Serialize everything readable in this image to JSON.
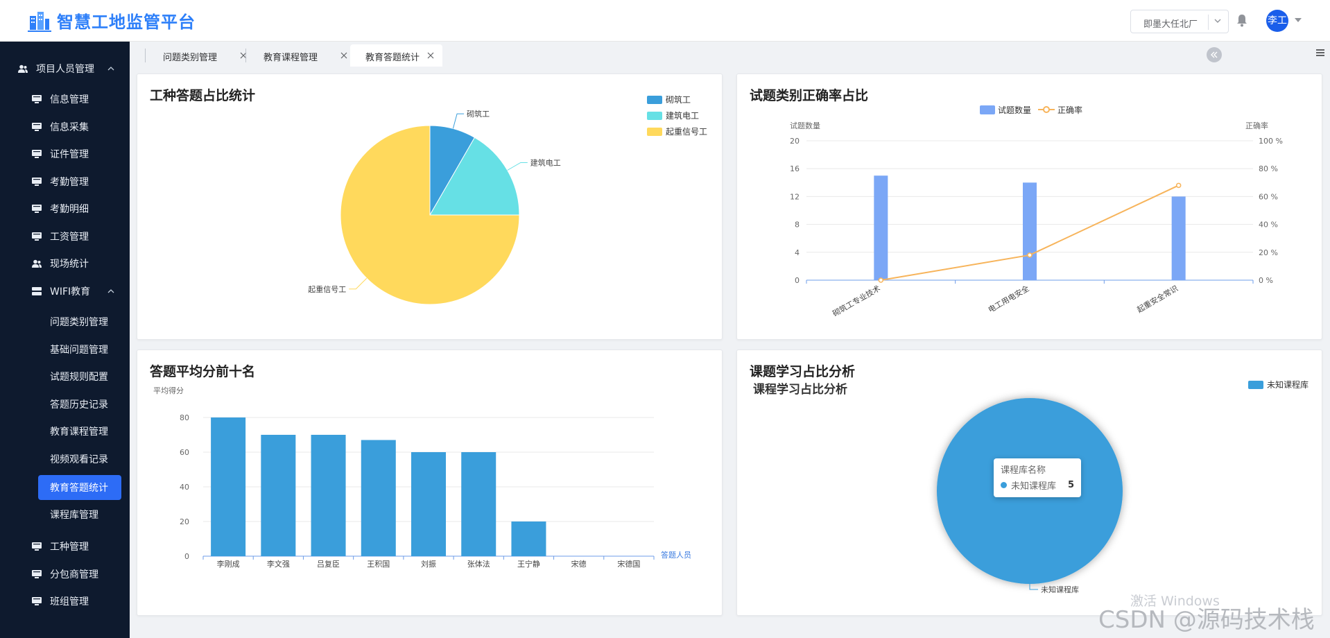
{
  "header": {
    "app_title": "智慧工地监管平台",
    "site_select": "即墨大任北厂",
    "user_avatar": "李工"
  },
  "sidebar": {
    "group1": "项目人员管理",
    "items1": [
      "信息管理",
      "信息采集",
      "证件管理",
      "考勤管理",
      "考勤明细",
      "工资管理",
      "现场统计"
    ],
    "group2": "WIFI教育",
    "wifi_items": [
      "问题类别管理",
      "基础问题管理",
      "试题规则配置",
      "答题历史记录",
      "教育课程管理",
      "视频观看记录",
      "教育答题统计",
      "课程库管理"
    ],
    "items2": [
      "工种管理",
      "分包商管理",
      "班组管理"
    ]
  },
  "tabs": [
    {
      "label": "问题类别管理",
      "active": false
    },
    {
      "label": "教育课程管理",
      "active": false
    },
    {
      "label": "教育答题统计",
      "active": true
    }
  ],
  "colors": {
    "accent": "#2d6cf6",
    "sidebar_bg": "#0e1a2e",
    "pie_blue": "#3a9edb",
    "pie_cyan": "#66e0e5",
    "pie_yellow": "#ffd95c",
    "bar_blue": "#7ba7f6",
    "line_orange": "#f7b45b"
  },
  "charts": {
    "pie1_title": "工种答题占比统计",
    "combo_title": "试题类别正确率占比",
    "bar_title": "答题平均分前十名",
    "course_title": "课题学习占比分析",
    "course_subtitle": "课程学习占比分析",
    "tooltip": {
      "header": "课程库名称",
      "name": "未知课程库",
      "value": "5"
    }
  },
  "chart_data": [
    {
      "type": "pie",
      "title": "工种答题占比统计",
      "legend": [
        "砌筑工",
        "建筑电工",
        "起重信号工"
      ],
      "legend_position": "top-right",
      "slices": [
        {
          "name": "砌筑工",
          "value": 1
        },
        {
          "name": "建筑电工",
          "value": 2
        },
        {
          "name": "起重信号工",
          "value": 9
        }
      ]
    },
    {
      "type": "bar",
      "title": "试题类别正确率占比",
      "categories": [
        "砌筑工专业技术",
        "电工用电安全",
        "起重安全常识"
      ],
      "series": [
        {
          "name": "试题数量",
          "type": "bar",
          "values": [
            15,
            14,
            12
          ]
        },
        {
          "name": "正确率",
          "type": "line",
          "values": [
            0,
            18,
            68
          ]
        }
      ],
      "ylabel": "试题数量",
      "ylim": [
        0,
        20
      ],
      "yticks": [
        0,
        4,
        8,
        12,
        16,
        20
      ],
      "y2label": "正确率",
      "y2lim": [
        0,
        100
      ],
      "y2ticks": [
        "0 %",
        "20 %",
        "40 %",
        "60 %",
        "80 %",
        "100 %"
      ],
      "legend_position": "top-center",
      "grid": true
    },
    {
      "type": "bar",
      "title": "答题平均分前十名",
      "categories": [
        "李刚成",
        "李文强",
        "吕复臣",
        "王积国",
        "刘振",
        "张体法",
        "王宁静",
        "宋德",
        "宋德国"
      ],
      "values": [
        80,
        70,
        70,
        67,
        60,
        60,
        20,
        0,
        0
      ],
      "ylabel": "平均得分",
      "xlabel": "答题人员",
      "ylim": [
        0,
        80
      ],
      "yticks": [
        0,
        20,
        40,
        60,
        80
      ],
      "grid": true
    },
    {
      "type": "pie",
      "title": "课题学习占比分析",
      "subtitle": "课程学习占比分析",
      "legend": [
        "未知课程库"
      ],
      "legend_position": "top-right",
      "slices": [
        {
          "name": "未知课程库",
          "value": 5
        }
      ]
    }
  ],
  "watermark": {
    "line1": "激活 Windows",
    "line2": "CSDN @源码技术栈"
  }
}
